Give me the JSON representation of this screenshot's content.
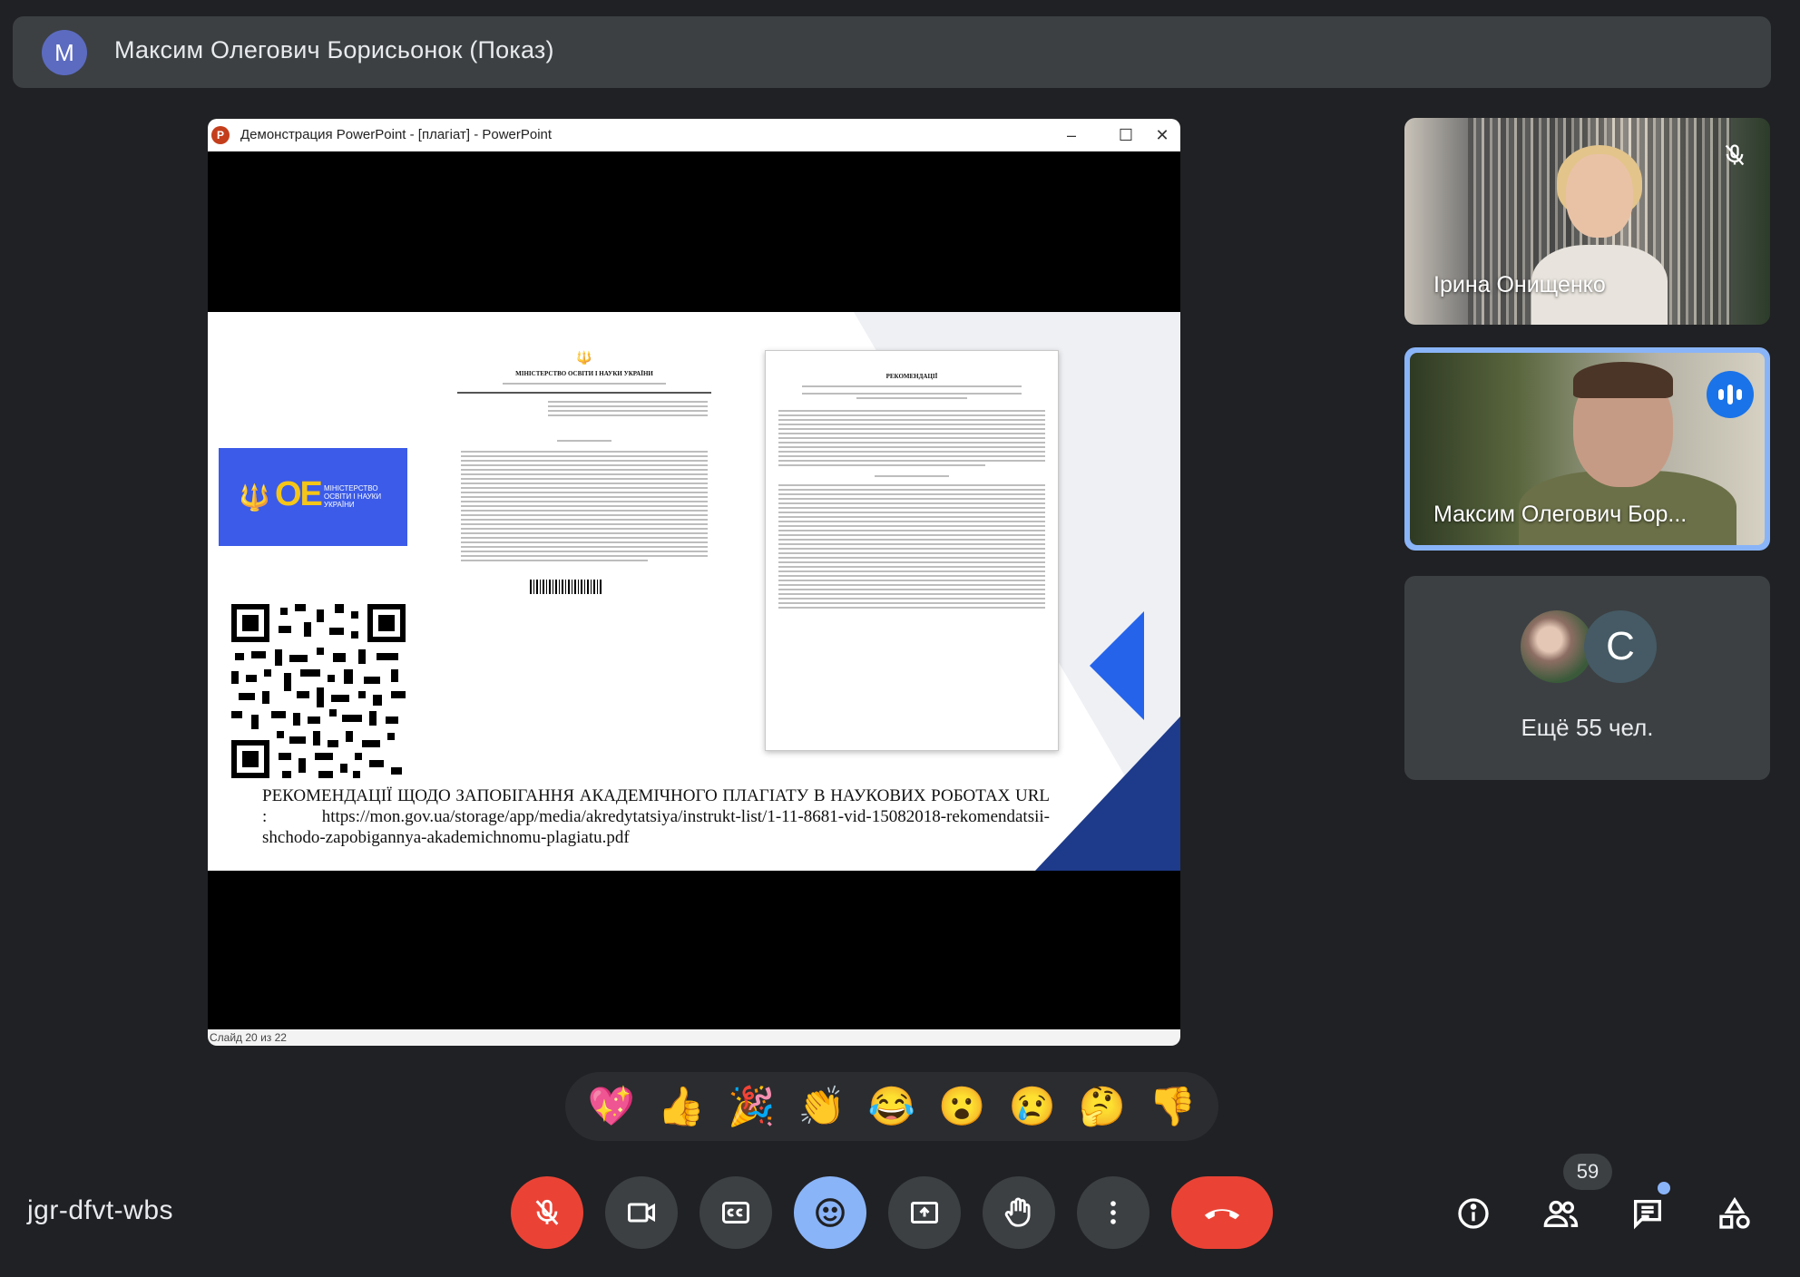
{
  "presenter": {
    "avatar_letter": "M",
    "title": "Максим Олегович Борисьонок (Показ)"
  },
  "window": {
    "app_icon": "P",
    "title": "Демонстрация PowerPoint - [плагіат] - PowerPoint",
    "minimize": "–",
    "maximize": "☐",
    "close": "✕",
    "status": "Слайд 20 из 22"
  },
  "slide": {
    "logo_text": "Міністерство освіти і науки України",
    "doc1_heading": "МІНІСТЕРСТВО ОСВІТИ І НАУКИ УКРАЇНИ",
    "doc2_heading": "РЕКОМЕНДАЦІЇ",
    "caption": "РЕКОМЕНДАЦІЇ ЩОДО ЗАПОБІГАННЯ АКАДЕМІЧНОГО ПЛАГІАТУ В НАУКОВИХ РОБОТАХ URL : https://mon.gov.ua/storage/app/media/akredytatsiya/instrukt-list/1-11-8681-vid-15082018-rekomendatsii-shchodo-zapobigannya-akademichnomu-plagiatu.pdf"
  },
  "participants": [
    {
      "name": "Ірина Онищенко",
      "muted": true
    },
    {
      "name": "Максим Олегович Бор...",
      "speaking": true
    }
  ],
  "others": {
    "avatar_letter": "С",
    "label": "Ещё 55 чел."
  },
  "reactions": [
    "💖",
    "👍",
    "🎉",
    "👏",
    "😂",
    "😮",
    "😢",
    "🤔",
    "👎"
  ],
  "meeting_code": "jgr-dfvt-wbs",
  "participant_count": "59",
  "colors": {
    "accent": "#8ab4f8",
    "danger": "#ea4335",
    "surface": "#3c4043",
    "background": "#202124"
  }
}
